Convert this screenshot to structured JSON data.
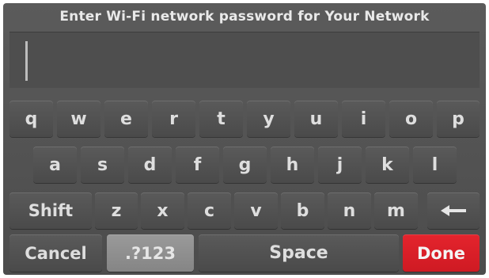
{
  "header": {
    "title": "Enter Wi-Fi network password for Your Network"
  },
  "password_field": {
    "value": ""
  },
  "keyboard": {
    "row1": [
      "q",
      "w",
      "e",
      "r",
      "t",
      "y",
      "u",
      "i",
      "o",
      "p"
    ],
    "row2": [
      "a",
      "s",
      "d",
      "f",
      "g",
      "h",
      "j",
      "k",
      "l"
    ],
    "row3": [
      "z",
      "x",
      "c",
      "v",
      "b",
      "n",
      "m"
    ],
    "shift_label": "Shift",
    "cancel_label": "Cancel",
    "symbols_label": ".?123",
    "space_label": "Space",
    "done_label": "Done",
    "backspace_icon": "left-arrow-icon"
  },
  "colors": {
    "background": "#515151",
    "key": "#525252",
    "symbols_key": "#8f8f8f",
    "done_key": "#d91f28",
    "text": "#dedede"
  }
}
